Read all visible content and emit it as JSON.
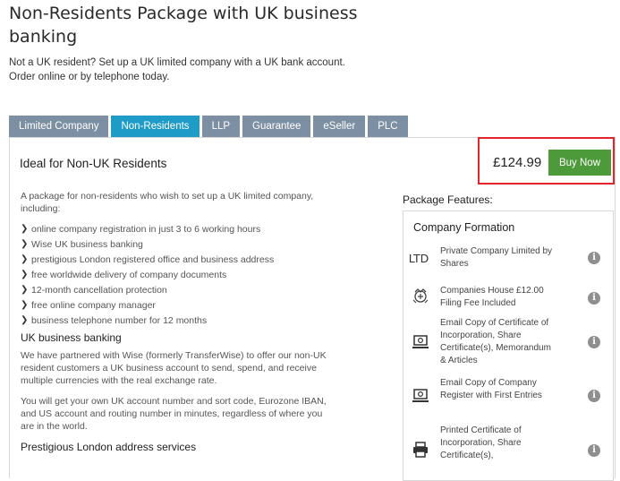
{
  "page": {
    "title_line1": "Non-Residents Package with UK business",
    "title_line2": "banking",
    "subtitle_line1": "Not a UK resident? Set up a UK limited company with a UK bank account.",
    "subtitle_line2": "Order online or by telephone today."
  },
  "tabs": [
    {
      "label": "Limited Company",
      "active": false
    },
    {
      "label": "Non-Residents",
      "active": true
    },
    {
      "label": "LLP",
      "active": false
    },
    {
      "label": "Guarantee",
      "active": false
    },
    {
      "label": "eSeller",
      "active": false
    },
    {
      "label": "PLC",
      "active": false
    }
  ],
  "panel": {
    "title": "Ideal for Non-UK Residents",
    "price": "£124.99",
    "buy_label": "Buy Now"
  },
  "description": {
    "intro": "A package for non-residents who wish to set up a UK limited company, including:",
    "features": [
      "online company registration in just 3 to 6 working hours",
      "Wise UK business banking",
      "prestigious London registered office and business address",
      "free worldwide delivery of company documents",
      "12-month cancellation protection",
      "free online company manager",
      "business telephone number for 12 months"
    ],
    "banking_heading": "UK business banking",
    "banking_para1": "We have partnered with Wise (formerly TransferWise) to offer our non-UK resident customers a UK business account to send, spend, and receive multiple currencies with the real exchange rate.",
    "banking_para2": "You will get your own UK account number and sort code, Eurozone IBAN, and US account and routing number in minutes, regardless of where you are in the world.",
    "london_heading": "Prestigious London address services"
  },
  "package_features": {
    "label": "Package Features:",
    "section_title": "Company Formation",
    "items": [
      {
        "icon": "ltd-icon",
        "icon_text": "LTD",
        "text": "Private Company Limited by Shares"
      },
      {
        "icon": "crest-icon",
        "text": "Companies House £12.00 Filing Fee Included"
      },
      {
        "icon": "email-document-icon",
        "text": "Email Copy of Certificate of Incorporation, Share Certificate(s), Memorandum & Articles"
      },
      {
        "icon": "email-document-icon",
        "text": "Email Copy of Company Register with First Entries"
      },
      {
        "icon": "printer-icon",
        "text": "Printed Certificate of Incorporation, Share Certificate(s),"
      }
    ]
  },
  "colors": {
    "tab_inactive": "#7d8fa3",
    "tab_active": "#1e9cc7",
    "buy_button": "#4d9a3a",
    "highlight_border": "#e3242b"
  }
}
